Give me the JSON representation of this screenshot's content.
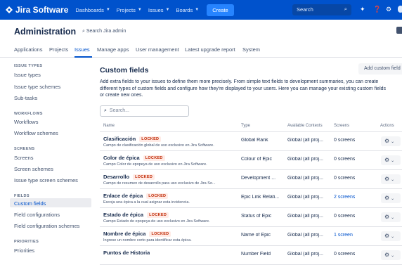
{
  "topnav": {
    "product": "Jira Software",
    "items": [
      {
        "label": "Dashboards"
      },
      {
        "label": "Projects"
      },
      {
        "label": "Issues"
      },
      {
        "label": "Boards"
      }
    ],
    "create_label": "Create",
    "search_placeholder": "Search",
    "brand_color": "#0052cc"
  },
  "header": {
    "title": "Administration",
    "search_label": "Search Jira admin"
  },
  "tabs": [
    {
      "label": "Applications"
    },
    {
      "label": "Projects"
    },
    {
      "label": "Issues",
      "active": true
    },
    {
      "label": "Manage apps"
    },
    {
      "label": "User management"
    },
    {
      "label": "Latest upgrade report"
    },
    {
      "label": "System"
    }
  ],
  "sidebar": {
    "sections": [
      {
        "heading": "ISSUE TYPES",
        "items": [
          "Issue types",
          "Issue type schemes",
          "Sub-tasks"
        ]
      },
      {
        "heading": "WORKFLOWS",
        "items": [
          "Workflows",
          "Workflow schemes"
        ]
      },
      {
        "heading": "SCREENS",
        "items": [
          "Screens",
          "Screen schemes",
          "Issue type screen schemes"
        ]
      },
      {
        "heading": "FIELDS",
        "items": [
          "Custom fields",
          "Field configurations",
          "Field configuration schemes"
        ]
      },
      {
        "heading": "PRIORITIES",
        "items": [
          "Priorities"
        ]
      }
    ],
    "active_item": "Custom fields"
  },
  "main": {
    "title": "Custom fields",
    "add_button": "Add custom field",
    "description_line1": "Add extra fields to your issues to define them more precisely. From simple text fields to development summaries, you can create",
    "description_line2": "different types of custom fields and configure how they're displayed to your users. Here you can manage your existing custom fields",
    "description_line3": "or create new ones.",
    "filter_placeholder": "Search...",
    "columns": {
      "name": "Name",
      "type": "Type",
      "contexts": "Available Contexts",
      "screens": "Screens",
      "actions": "Actions"
    },
    "locked_label": "LOCKED",
    "rows": [
      {
        "name": "Clasificación",
        "locked": true,
        "desc": "Campo de clasificación global de uso exclusivo en Jira Software.",
        "type": "Global Rank",
        "context": "Global (all proj...",
        "screens": "0 screens",
        "screens_link": false
      },
      {
        "name": "Color de épica",
        "locked": true,
        "desc": "Campo Color de epopeya de uso exclusivo en Jira Software.",
        "type": "Colour of Epic",
        "context": "Global (all proj...",
        "screens": "0 screens",
        "screens_link": false
      },
      {
        "name": "Desarrollo",
        "locked": true,
        "desc": "Campo de resumen de desarrollo para uso exclusivo de Jira So...",
        "type": "Development ...",
        "context": "Global (all proj...",
        "screens": "0 screens",
        "screens_link": false
      },
      {
        "name": "Enlace de épica",
        "locked": true,
        "desc": "Escoja una épica a la cual asignar esta incidencia.",
        "type": "Epic Link Relati...",
        "context": "Global (all proj...",
        "screens": "2 screens",
        "screens_link": true
      },
      {
        "name": "Estado de épica",
        "locked": true,
        "desc": "Campo Estado de epopeya de uso exclusivo en Jira Software.",
        "type": "Status of Epic",
        "context": "Global (all proj...",
        "screens": "0 screens",
        "screens_link": false
      },
      {
        "name": "Nombre de épica",
        "locked": true,
        "desc": "Ingrese un nombre corto para identificar esta épica.",
        "type": "Name of Epic",
        "context": "Global (all proj...",
        "screens": "1 screen",
        "screens_link": true
      },
      {
        "name": "Puntos de Historia",
        "locked": false,
        "desc": "",
        "type": "Number Field",
        "context": "Global (all proj...",
        "screens": "0 screens",
        "screens_link": false
      }
    ]
  }
}
